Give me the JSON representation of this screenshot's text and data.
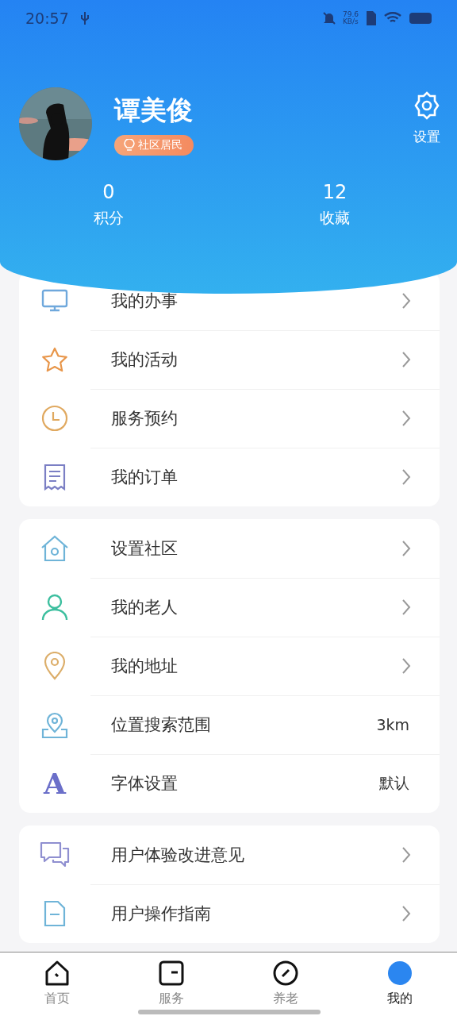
{
  "status_bar": {
    "time": "20:57",
    "speed": "79.6",
    "speed_unit": "KB/s"
  },
  "profile": {
    "name": "谭美俊",
    "badge": "社区居民",
    "settings_label": "设置"
  },
  "stats": [
    {
      "value": "0",
      "label": "积分"
    },
    {
      "value": "12",
      "label": "收藏"
    }
  ],
  "menu_groups": [
    {
      "items": [
        {
          "label": "我的办事"
        },
        {
          "label": "我的活动"
        },
        {
          "label": "服务预约"
        },
        {
          "label": "我的订单"
        }
      ]
    },
    {
      "items": [
        {
          "label": "设置社区"
        },
        {
          "label": "我的老人"
        },
        {
          "label": "我的地址"
        },
        {
          "label": "位置搜索范围",
          "value": "3km"
        },
        {
          "label": "字体设置",
          "value": "默认",
          "icon_text": "A"
        }
      ]
    },
    {
      "items": [
        {
          "label": "用户体验改进意见"
        },
        {
          "label": "用户操作指南"
        }
      ]
    }
  ],
  "tab_bar": [
    {
      "label": "首页",
      "selected": false
    },
    {
      "label": "服务",
      "selected": false
    },
    {
      "label": "养老",
      "selected": false
    },
    {
      "label": "我的",
      "selected": true
    }
  ]
}
